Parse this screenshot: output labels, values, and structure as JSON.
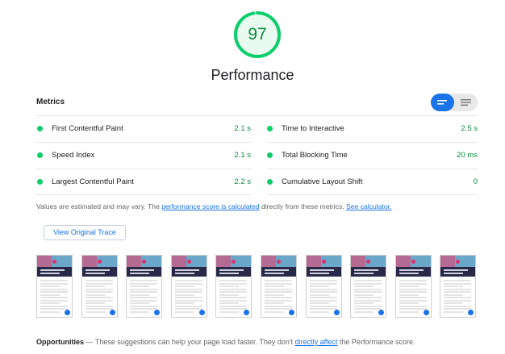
{
  "score": {
    "value": "97",
    "fraction": 0.97,
    "title": "Performance",
    "color": "#0cce6b"
  },
  "metrics": {
    "header": "Metrics",
    "view_toggle": [
      "bars-view-icon",
      "list-view-icon"
    ],
    "items": [
      {
        "label": "First Contentful Paint",
        "value": "2.1 s",
        "status": "pass"
      },
      {
        "label": "Time to Interactive",
        "value": "2.5 s",
        "status": "pass"
      },
      {
        "label": "Speed Index",
        "value": "2.1 s",
        "status": "pass"
      },
      {
        "label": "Total Blocking Time",
        "value": "20 ms",
        "status": "pass"
      },
      {
        "label": "Largest Contentful Paint",
        "value": "2.2 s",
        "status": "pass"
      },
      {
        "label": "Cumulative Layout Shift",
        "value": "0",
        "status": "pass"
      }
    ]
  },
  "note": {
    "prefix": "Values are estimated and may vary. The ",
    "link1": "performance score is calculated",
    "middle": " directly from these metrics. ",
    "link2": "See calculator."
  },
  "trace_button": "View Original Trace",
  "filmstrip": {
    "frame_count": 10
  },
  "opportunities": {
    "title": "Opportunities",
    "dash": " — ",
    "text": "These suggestions can help your page load faster. They don't ",
    "link": "directly affect",
    "suffix": " the Performance score."
  }
}
